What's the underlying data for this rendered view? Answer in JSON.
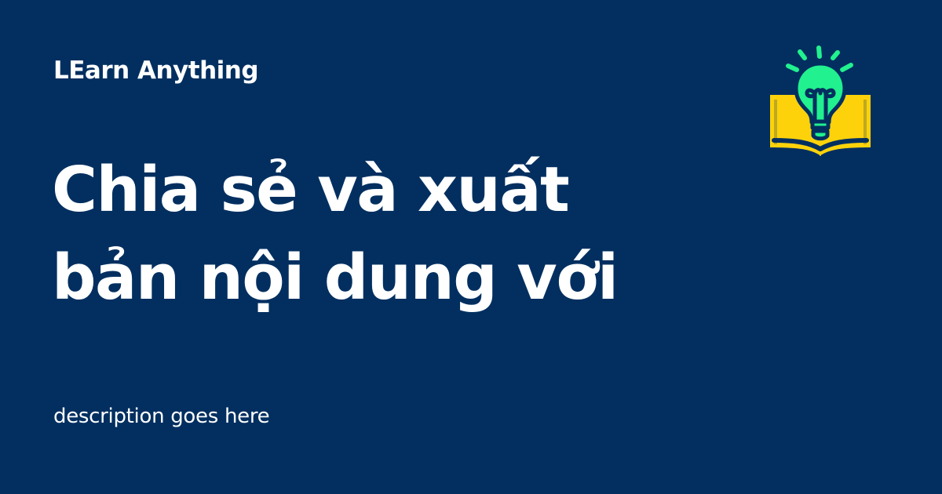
{
  "brand": {
    "name": "LEarn Anything"
  },
  "headline": {
    "line1": "Chia sẻ và xuất",
    "line2": "bản nội dung với"
  },
  "description": "description goes here",
  "logo": {
    "icon": "lightbulb-book-icon"
  },
  "colors": {
    "background": "#022f60",
    "text": "#ffffff",
    "book": "#fdd20b",
    "bulb": "#21f18e"
  }
}
